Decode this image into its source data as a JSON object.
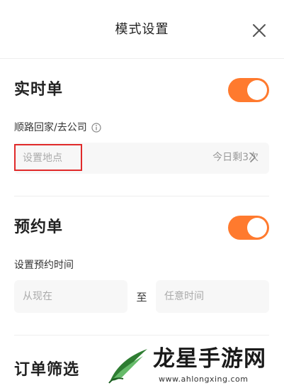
{
  "header": {
    "title": "模式设置"
  },
  "realtime": {
    "title": "实时单",
    "toggle_on": true,
    "route_label": "顺路回家/去公司",
    "location_placeholder": "设置地点",
    "remaining": "今日剩3次"
  },
  "reservation": {
    "title": "预约单",
    "toggle_on": true,
    "time_label": "设置预约时间",
    "from_placeholder": "从现在",
    "to_text": "至",
    "to_placeholder": "任意时间"
  },
  "filter": {
    "title": "订单筛选"
  },
  "watermark": {
    "title": "龙星手游网",
    "url": "www.ahlongxing.com"
  },
  "colors": {
    "accent": "#ff7a2e",
    "highlight": "#e02a2a"
  }
}
